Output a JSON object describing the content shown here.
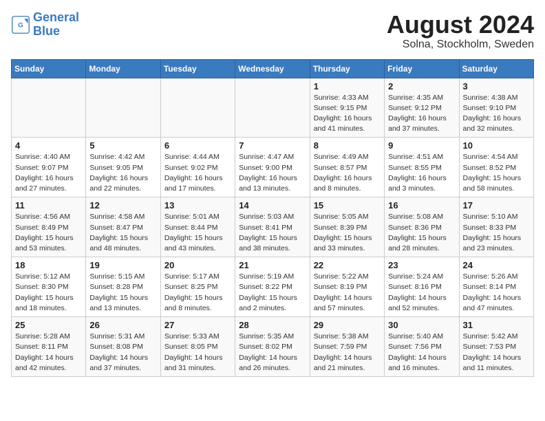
{
  "logo": {
    "line1": "General",
    "line2": "Blue"
  },
  "title": "August 2024",
  "subtitle": "Solna, Stockholm, Sweden",
  "days_of_week": [
    "Sunday",
    "Monday",
    "Tuesday",
    "Wednesday",
    "Thursday",
    "Friday",
    "Saturday"
  ],
  "weeks": [
    [
      {
        "day": "",
        "detail": ""
      },
      {
        "day": "",
        "detail": ""
      },
      {
        "day": "",
        "detail": ""
      },
      {
        "day": "",
        "detail": ""
      },
      {
        "day": "1",
        "detail": "Sunrise: 4:33 AM\nSunset: 9:15 PM\nDaylight: 16 hours\nand 41 minutes."
      },
      {
        "day": "2",
        "detail": "Sunrise: 4:35 AM\nSunset: 9:12 PM\nDaylight: 16 hours\nand 37 minutes."
      },
      {
        "day": "3",
        "detail": "Sunrise: 4:38 AM\nSunset: 9:10 PM\nDaylight: 16 hours\nand 32 minutes."
      }
    ],
    [
      {
        "day": "4",
        "detail": "Sunrise: 4:40 AM\nSunset: 9:07 PM\nDaylight: 16 hours\nand 27 minutes."
      },
      {
        "day": "5",
        "detail": "Sunrise: 4:42 AM\nSunset: 9:05 PM\nDaylight: 16 hours\nand 22 minutes."
      },
      {
        "day": "6",
        "detail": "Sunrise: 4:44 AM\nSunset: 9:02 PM\nDaylight: 16 hours\nand 17 minutes."
      },
      {
        "day": "7",
        "detail": "Sunrise: 4:47 AM\nSunset: 9:00 PM\nDaylight: 16 hours\nand 13 minutes."
      },
      {
        "day": "8",
        "detail": "Sunrise: 4:49 AM\nSunset: 8:57 PM\nDaylight: 16 hours\nand 8 minutes."
      },
      {
        "day": "9",
        "detail": "Sunrise: 4:51 AM\nSunset: 8:55 PM\nDaylight: 16 hours\nand 3 minutes."
      },
      {
        "day": "10",
        "detail": "Sunrise: 4:54 AM\nSunset: 8:52 PM\nDaylight: 15 hours\nand 58 minutes."
      }
    ],
    [
      {
        "day": "11",
        "detail": "Sunrise: 4:56 AM\nSunset: 8:49 PM\nDaylight: 15 hours\nand 53 minutes."
      },
      {
        "day": "12",
        "detail": "Sunrise: 4:58 AM\nSunset: 8:47 PM\nDaylight: 15 hours\nand 48 minutes."
      },
      {
        "day": "13",
        "detail": "Sunrise: 5:01 AM\nSunset: 8:44 PM\nDaylight: 15 hours\nand 43 minutes."
      },
      {
        "day": "14",
        "detail": "Sunrise: 5:03 AM\nSunset: 8:41 PM\nDaylight: 15 hours\nand 38 minutes."
      },
      {
        "day": "15",
        "detail": "Sunrise: 5:05 AM\nSunset: 8:39 PM\nDaylight: 15 hours\nand 33 minutes."
      },
      {
        "day": "16",
        "detail": "Sunrise: 5:08 AM\nSunset: 8:36 PM\nDaylight: 15 hours\nand 28 minutes."
      },
      {
        "day": "17",
        "detail": "Sunrise: 5:10 AM\nSunset: 8:33 PM\nDaylight: 15 hours\nand 23 minutes."
      }
    ],
    [
      {
        "day": "18",
        "detail": "Sunrise: 5:12 AM\nSunset: 8:30 PM\nDaylight: 15 hours\nand 18 minutes."
      },
      {
        "day": "19",
        "detail": "Sunrise: 5:15 AM\nSunset: 8:28 PM\nDaylight: 15 hours\nand 13 minutes."
      },
      {
        "day": "20",
        "detail": "Sunrise: 5:17 AM\nSunset: 8:25 PM\nDaylight: 15 hours\nand 8 minutes."
      },
      {
        "day": "21",
        "detail": "Sunrise: 5:19 AM\nSunset: 8:22 PM\nDaylight: 15 hours\nand 2 minutes."
      },
      {
        "day": "22",
        "detail": "Sunrise: 5:22 AM\nSunset: 8:19 PM\nDaylight: 14 hours\nand 57 minutes."
      },
      {
        "day": "23",
        "detail": "Sunrise: 5:24 AM\nSunset: 8:16 PM\nDaylight: 14 hours\nand 52 minutes."
      },
      {
        "day": "24",
        "detail": "Sunrise: 5:26 AM\nSunset: 8:14 PM\nDaylight: 14 hours\nand 47 minutes."
      }
    ],
    [
      {
        "day": "25",
        "detail": "Sunrise: 5:28 AM\nSunset: 8:11 PM\nDaylight: 14 hours\nand 42 minutes."
      },
      {
        "day": "26",
        "detail": "Sunrise: 5:31 AM\nSunset: 8:08 PM\nDaylight: 14 hours\nand 37 minutes."
      },
      {
        "day": "27",
        "detail": "Sunrise: 5:33 AM\nSunset: 8:05 PM\nDaylight: 14 hours\nand 31 minutes."
      },
      {
        "day": "28",
        "detail": "Sunrise: 5:35 AM\nSunset: 8:02 PM\nDaylight: 14 hours\nand 26 minutes."
      },
      {
        "day": "29",
        "detail": "Sunrise: 5:38 AM\nSunset: 7:59 PM\nDaylight: 14 hours\nand 21 minutes."
      },
      {
        "day": "30",
        "detail": "Sunrise: 5:40 AM\nSunset: 7:56 PM\nDaylight: 14 hours\nand 16 minutes."
      },
      {
        "day": "31",
        "detail": "Sunrise: 5:42 AM\nSunset: 7:53 PM\nDaylight: 14 hours\nand 11 minutes."
      }
    ]
  ]
}
